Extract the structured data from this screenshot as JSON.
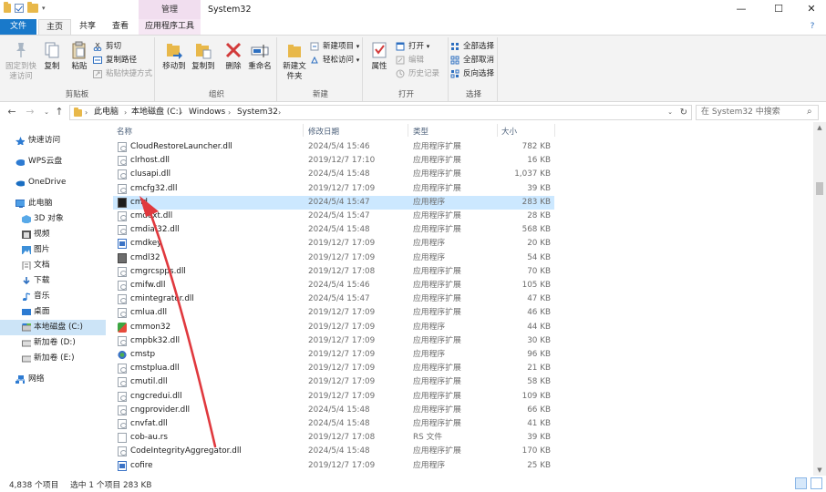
{
  "window": {
    "title": "System32",
    "manage_tab": "管理",
    "minimize": "—",
    "maximize": "☐",
    "close": "✕"
  },
  "tabs": {
    "file": "文件",
    "home": "主页",
    "share": "共享",
    "view": "查看",
    "app_tools": "应用程序工具",
    "help": "?"
  },
  "ribbon": {
    "clipboard": {
      "label": "剪贴板",
      "pin": "固定到快速访问",
      "copy": "复制",
      "paste": "粘贴",
      "cut": "剪切",
      "copy_path": "复制路径",
      "paste_shortcut": "粘贴快捷方式"
    },
    "organize": {
      "label": "组织",
      "move_to": "移动到",
      "copy_to": "复制到",
      "delete": "删除",
      "rename": "重命名"
    },
    "new": {
      "label": "新建",
      "new_folder": "新建文件夹",
      "new_item": "新建项目",
      "easy_access": "轻松访问"
    },
    "open": {
      "label": "打开",
      "properties": "属性",
      "open": "打开",
      "edit": "编辑",
      "history": "历史记录"
    },
    "select": {
      "label": "选择",
      "select_all": "全部选择",
      "select_none": "全部取消",
      "invert": "反向选择"
    }
  },
  "address": {
    "crumbs": [
      "此电脑",
      "本地磁盘 (C:)",
      "Windows",
      "System32"
    ],
    "search_placeholder": "在 System32 中搜索"
  },
  "nav": {
    "items": [
      {
        "label": "快速访问",
        "icon": "star-icon"
      },
      {
        "label": "WPS云盘",
        "icon": "cloud-icon"
      },
      {
        "label": "OneDrive",
        "icon": "onedrive-icon"
      },
      {
        "label": "此电脑",
        "icon": "computer-icon"
      },
      {
        "label": "3D 对象",
        "icon": "cube-icon"
      },
      {
        "label": "视频",
        "icon": "video-icon"
      },
      {
        "label": "图片",
        "icon": "picture-icon"
      },
      {
        "label": "文档",
        "icon": "document-icon"
      },
      {
        "label": "下载",
        "icon": "download-icon"
      },
      {
        "label": "音乐",
        "icon": "music-icon"
      },
      {
        "label": "桌面",
        "icon": "desktop-icon"
      },
      {
        "label": "本地磁盘 (C:)",
        "icon": "drive-icon"
      },
      {
        "label": "新加卷 (D:)",
        "icon": "drive-icon"
      },
      {
        "label": "新加卷 (E:)",
        "icon": "drive-icon"
      },
      {
        "label": "网络",
        "icon": "network-icon"
      }
    ]
  },
  "filelist": {
    "columns": {
      "name": "名称",
      "date": "修改日期",
      "type": "类型",
      "size": "大小"
    },
    "rows": [
      {
        "name": "CloudRestoreLauncher.dll",
        "date": "2024/5/4 15:46",
        "type": "应用程序扩展",
        "size": "782 KB",
        "icon": "dll"
      },
      {
        "name": "clrhost.dll",
        "date": "2019/12/7 17:10",
        "type": "应用程序扩展",
        "size": "16 KB",
        "icon": "dll"
      },
      {
        "name": "clusapi.dll",
        "date": "2024/5/4 15:48",
        "type": "应用程序扩展",
        "size": "1,037 KB",
        "icon": "dll"
      },
      {
        "name": "cmcfg32.dll",
        "date": "2019/12/7 17:09",
        "type": "应用程序扩展",
        "size": "39 KB",
        "icon": "dll"
      },
      {
        "name": "cmd",
        "date": "2024/5/4 15:47",
        "type": "应用程序",
        "size": "283 KB",
        "icon": "exe-cmd",
        "selected": true
      },
      {
        "name": "cmdext.dll",
        "date": "2024/5/4 15:47",
        "type": "应用程序扩展",
        "size": "28 KB",
        "icon": "dll"
      },
      {
        "name": "cmdial32.dll",
        "date": "2024/5/4 15:48",
        "type": "应用程序扩展",
        "size": "568 KB",
        "icon": "dll"
      },
      {
        "name": "cmdkey",
        "date": "2019/12/7 17:09",
        "type": "应用程序",
        "size": "20 KB",
        "icon": "exe-blue"
      },
      {
        "name": "cmdl32",
        "date": "2019/12/7 17:09",
        "type": "应用程序",
        "size": "54 KB",
        "icon": "exe-grey"
      },
      {
        "name": "cmgrcspps.dll",
        "date": "2019/12/7 17:08",
        "type": "应用程序扩展",
        "size": "70 KB",
        "icon": "dll"
      },
      {
        "name": "cmifw.dll",
        "date": "2024/5/4 15:46",
        "type": "应用程序扩展",
        "size": "105 KB",
        "icon": "dll"
      },
      {
        "name": "cmintegrator.dll",
        "date": "2024/5/4 15:47",
        "type": "应用程序扩展",
        "size": "47 KB",
        "icon": "dll"
      },
      {
        "name": "cmlua.dll",
        "date": "2019/12/7 17:09",
        "type": "应用程序扩展",
        "size": "46 KB",
        "icon": "dll"
      },
      {
        "name": "cmmon32",
        "date": "2019/12/7 17:09",
        "type": "应用程序",
        "size": "44 KB",
        "icon": "exe-color"
      },
      {
        "name": "cmpbk32.dll",
        "date": "2019/12/7 17:09",
        "type": "应用程序扩展",
        "size": "30 KB",
        "icon": "dll"
      },
      {
        "name": "cmstp",
        "date": "2019/12/7 17:09",
        "type": "应用程序",
        "size": "96 KB",
        "icon": "exe-gear"
      },
      {
        "name": "cmstplua.dll",
        "date": "2019/12/7 17:09",
        "type": "应用程序扩展",
        "size": "21 KB",
        "icon": "dll"
      },
      {
        "name": "cmutil.dll",
        "date": "2019/12/7 17:09",
        "type": "应用程序扩展",
        "size": "58 KB",
        "icon": "dll"
      },
      {
        "name": "cngcredui.dll",
        "date": "2019/12/7 17:09",
        "type": "应用程序扩展",
        "size": "109 KB",
        "icon": "dll"
      },
      {
        "name": "cngprovider.dll",
        "date": "2024/5/4 15:48",
        "type": "应用程序扩展",
        "size": "66 KB",
        "icon": "dll"
      },
      {
        "name": "cnvfat.dll",
        "date": "2024/5/4 15:48",
        "type": "应用程序扩展",
        "size": "41 KB",
        "icon": "dll"
      },
      {
        "name": "cob-au.rs",
        "date": "2019/12/7 17:08",
        "type": "RS 文件",
        "size": "39 KB",
        "icon": "rs"
      },
      {
        "name": "CodeIntegrityAggregator.dll",
        "date": "2024/5/4 15:48",
        "type": "应用程序扩展",
        "size": "170 KB",
        "icon": "dll"
      },
      {
        "name": "cofire",
        "date": "2019/12/7 17:09",
        "type": "应用程序",
        "size": "25 KB",
        "icon": "exe-blue"
      }
    ]
  },
  "status": {
    "count": "4,838 个项目",
    "selection": "选中 1 个项目  283 KB"
  },
  "colors": {
    "accent": "#1979ca",
    "selection": "#cce8ff",
    "annotation_arrow": "#e0393e"
  }
}
